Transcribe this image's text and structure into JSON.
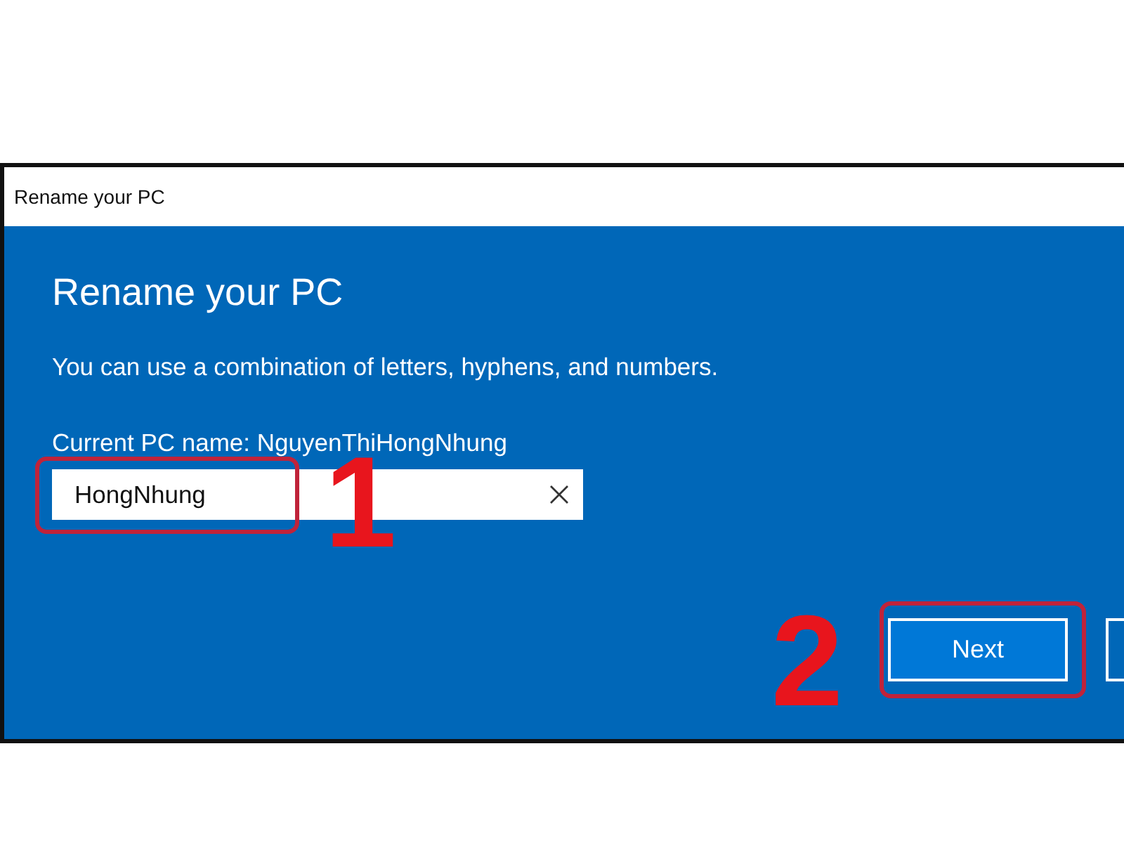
{
  "window": {
    "title": "Rename your PC"
  },
  "dialog": {
    "heading": "Rename your PC",
    "description": "You can use a combination of letters, hyphens, and numbers.",
    "current_name_label": "Current PC name: NguyenThiHongNhung",
    "name_field": {
      "value": "HongNhung"
    },
    "buttons": [
      {
        "label": "Next",
        "kind": "primary"
      },
      {
        "kind": "partial"
      }
    ]
  },
  "annotations": [
    {
      "label": "1"
    },
    {
      "label": "2"
    }
  ]
}
